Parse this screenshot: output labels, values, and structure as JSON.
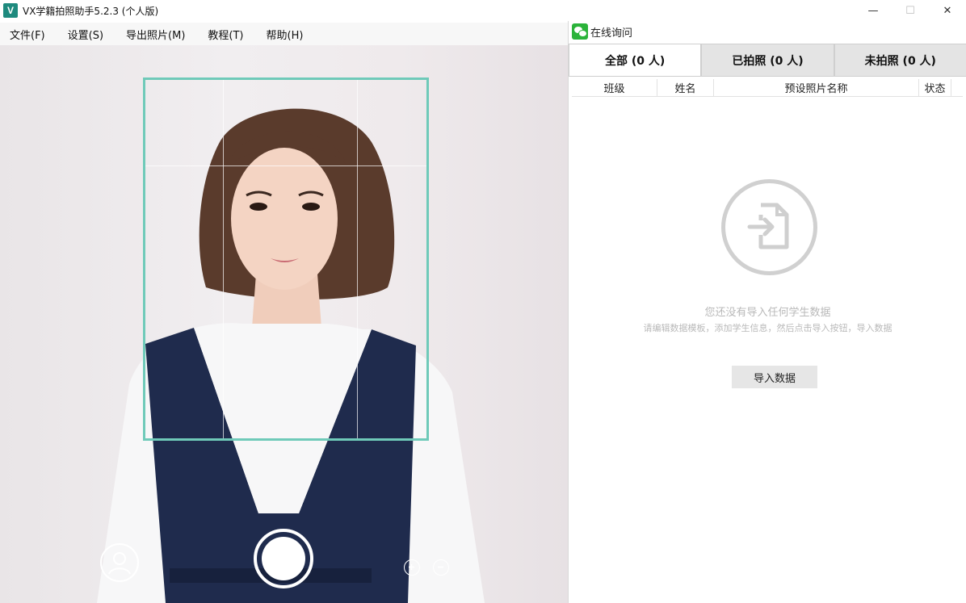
{
  "window": {
    "logo_text": "V",
    "title": "VX学籍拍照助手5.2.3 (个人版)",
    "minimize_glyph": "—",
    "maximize_glyph": "☐",
    "close_glyph": "✕"
  },
  "menu": {
    "items": [
      {
        "label": "文件(F)"
      },
      {
        "label": "设置(S)"
      },
      {
        "label": "导出照片(M)"
      },
      {
        "label": "教程(T)"
      },
      {
        "label": "帮助(H)"
      }
    ]
  },
  "wechat": {
    "label": "在线询问",
    "color": "#2bb33a"
  },
  "tabs": [
    {
      "label": "全部  (0 人)",
      "active": true
    },
    {
      "label": "已拍照  (0 人)",
      "active": false
    },
    {
      "label": "未拍照  (0 人)",
      "active": false
    }
  ],
  "table": {
    "columns": [
      "班级",
      "姓名",
      "预设照片名称",
      "状态"
    ]
  },
  "empty_state": {
    "icon": "import-file-icon",
    "title": "您还没有导入任何学生数据",
    "subtitle": "请编辑数据模板，添加学生信息，然后点击导入按钮，导入数据"
  },
  "import_button": {
    "label": "导入数据"
  },
  "camera": {
    "frame_color": "#6fcab9",
    "icons": [
      "avatar-icon",
      "shutter-button",
      "zoom-in-icon",
      "zoom-out-icon"
    ]
  }
}
